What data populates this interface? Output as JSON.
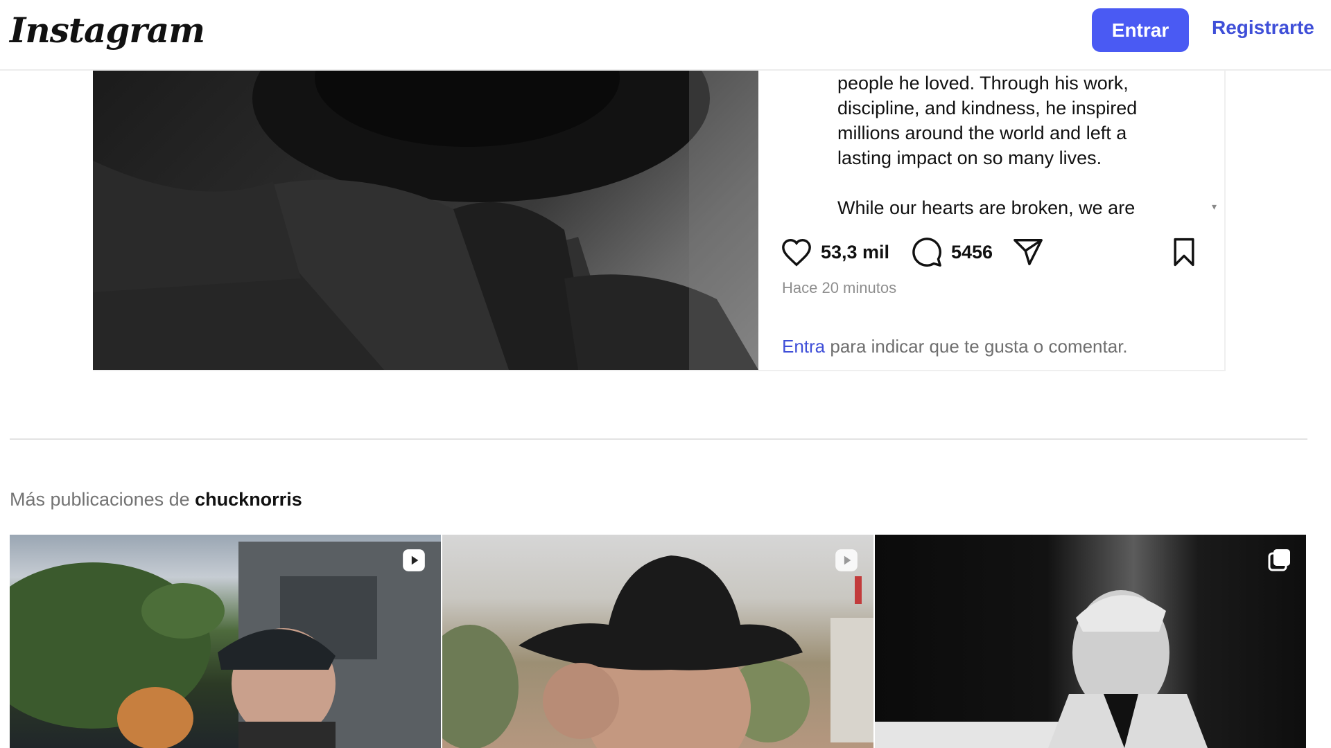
{
  "header": {
    "logo": "Instagram",
    "login_button": "Entrar",
    "register_link": "Registrarte"
  },
  "post": {
    "caption_lines": [
      "people he loved. Through his work,",
      "discipline, and kindness, he inspired",
      "millions around the world and left a",
      "lasting impact on so many lives."
    ],
    "caption_next": "While our hearts are broken, we are",
    "likes": "53,3 mil",
    "comments": "5456",
    "time": "Hace 20 minutos",
    "login_prompt_link": "Entra",
    "login_prompt_text": " para indicar que te gusta o comentar."
  },
  "more": {
    "prefix": "Más publicaciones de ",
    "username": "chucknorris"
  },
  "grid": [
    {
      "type": "reel-icon"
    },
    {
      "type": "reel-icon"
    },
    {
      "type": "carousel-icon"
    }
  ],
  "colors": {
    "accent": "#4a5af3",
    "link": "#3f4fd8",
    "muted": "#8e8e8e"
  }
}
